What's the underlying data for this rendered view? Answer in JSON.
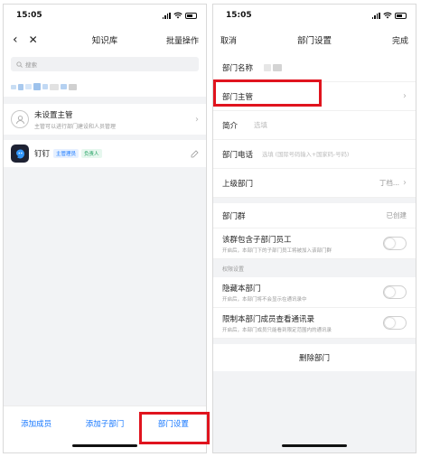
{
  "status": {
    "time": "15:05"
  },
  "left": {
    "nav": {
      "title": "知识库",
      "batch_label": "批量操作"
    },
    "search": {
      "placeholder": "搜索"
    },
    "manager_card": {
      "title": "未设置主管",
      "subtitle": "主管可以进行部门建设和人员管理"
    },
    "member": {
      "name": "钉钉",
      "tag_primary": "主管理员",
      "tag_owner": "负责人"
    },
    "bottom": {
      "add_member": "添加成员",
      "add_subdept": "添加子部门",
      "dept_settings": "部门设置"
    }
  },
  "right": {
    "nav": {
      "cancel": "取消",
      "title": "部门设置",
      "done": "完成"
    },
    "fields": {
      "dept_name_label": "部门名称",
      "dept_manager_label": "部门主管",
      "intro_label": "简介",
      "intro_placeholder": "选填",
      "phone_label": "部门电话",
      "phone_placeholder": "选填 (国际号码输入+国家码-号码)",
      "parent_label": "上级部门",
      "parent_value": "丁档..."
    },
    "group": {
      "label": "部门群",
      "status": "已创建",
      "include_sub_title": "该群包含子部门员工",
      "include_sub_sub": "开启后，本部门下的子部门员工将被加入该部门群"
    },
    "privacy": {
      "section_title": "权限设置",
      "hide_title": "隐藏本部门",
      "hide_sub": "开启后，本部门将不会显示在通讯录中",
      "restrict_title": "限制本部门成员查看通讯录",
      "restrict_sub": "开启后，本部门成员只能看到限定范围内的通讯录"
    },
    "delete_label": "删除部门"
  },
  "colors": {
    "accent": "#1677ff",
    "highlight": "#e0141e"
  }
}
